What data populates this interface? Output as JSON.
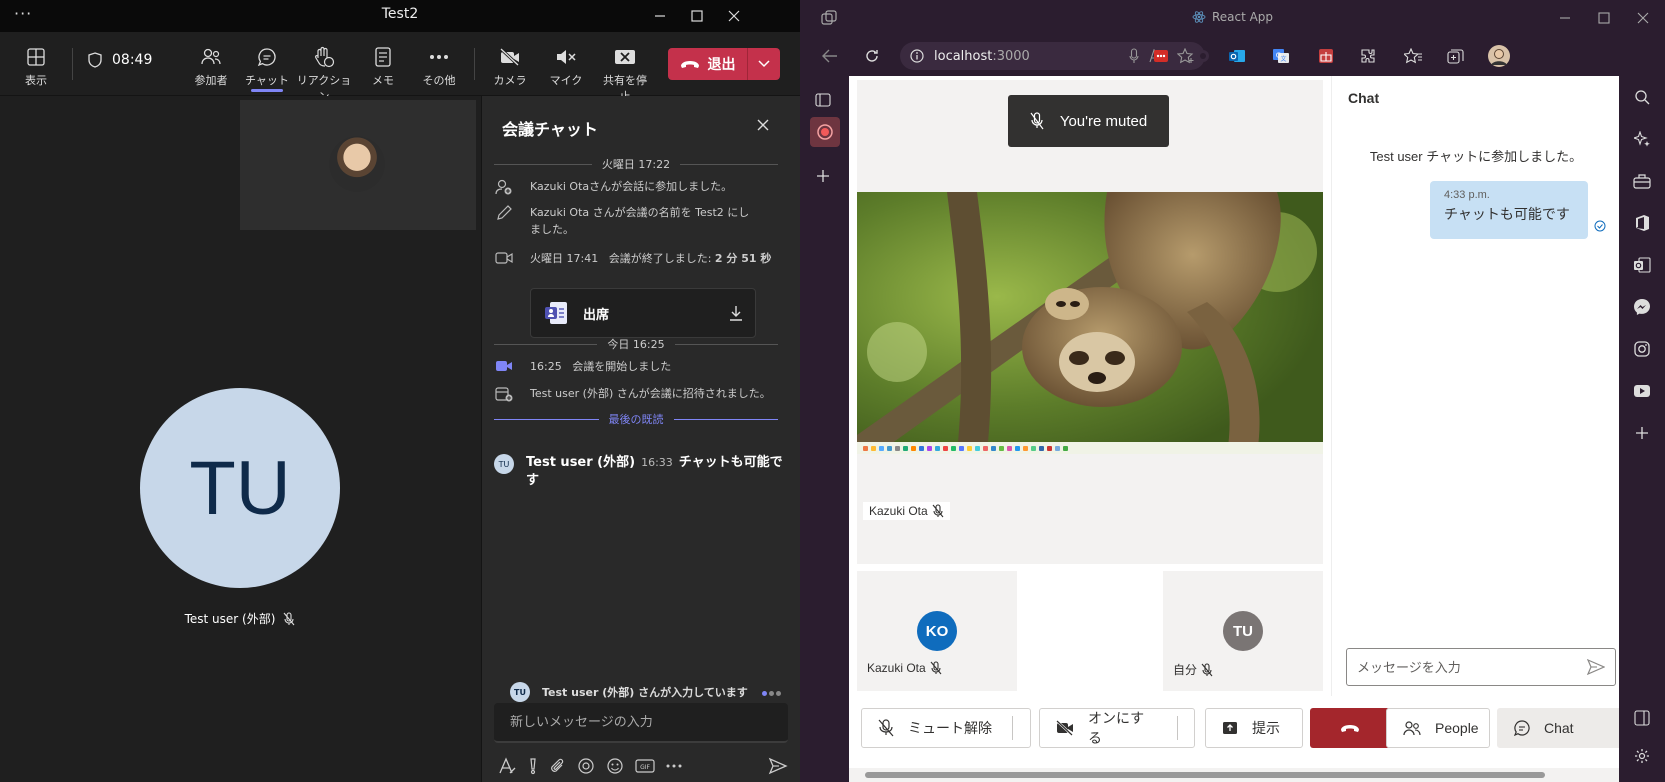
{
  "teams": {
    "window_title": "Test2",
    "toolbar": {
      "view": "表示",
      "timer": "08:49",
      "participants": "参加者",
      "chat": "チャット",
      "reactions": "リアクション",
      "notes": "メモ",
      "more": "その他",
      "camera": "カメラ",
      "mic": "マイク",
      "stop_share": "共有を停止",
      "leave": "退出"
    },
    "stage": {
      "avatar_initials": "TU",
      "participant_name": "Test user (外部)"
    },
    "chat": {
      "title": "会議チャット",
      "day1": "火曜日 17:22",
      "evt_joined": "Kazuki Otaさんが会話に参加しました。",
      "evt_renamed": "Kazuki Ota さんが会議の名前を Test2 にしました。",
      "evt_ended_time": "火曜日 17:41",
      "evt_ended_text": "会議が終了しました:",
      "evt_ended_duration": "2 分 51 秒",
      "attendance_card": "出席",
      "day2": "今日 16:25",
      "evt_started_time": "16:25",
      "evt_started_text": "会議を開始しました",
      "evt_invited": "Test user (外部) さんが会議に招待されました。",
      "last_read": "最後の既読",
      "msg_avatar": "TU",
      "msg_author": "Test user (外部)",
      "msg_time": "16:33",
      "msg_text": "チャットも可能です",
      "typing_avatar": "TU",
      "typing_text": "Test user (外部) さんが入力しています",
      "compose_placeholder": "新しいメッセージの入力"
    }
  },
  "edge": {
    "tab_title": "React App",
    "address_host": "localhost",
    "address_port": ":3000",
    "page": {
      "muted_toast": "You're muted",
      "share_owner": "Kazuki Ota",
      "tile1_initials": "KO",
      "tile1_name": "Kazuki Ota",
      "tile2_initials": "TU",
      "tile2_name": "自分",
      "chat_title": "Chat",
      "chat_system": "Test user チャットに参加しました。",
      "bubble_time": "4:33 p.m.",
      "bubble_text": "チャットも可能です",
      "send_placeholder": "メッセージを入力",
      "btn_unmute": "ミュート解除",
      "btn_camera": "オンにする",
      "btn_present": "提示",
      "btn_people": "People",
      "btn_chat": "Chat"
    },
    "colors": {
      "ko_avatar": "#0f6cbd",
      "tu_avatar": "#7a7574",
      "hangup": "#a4262c"
    }
  }
}
